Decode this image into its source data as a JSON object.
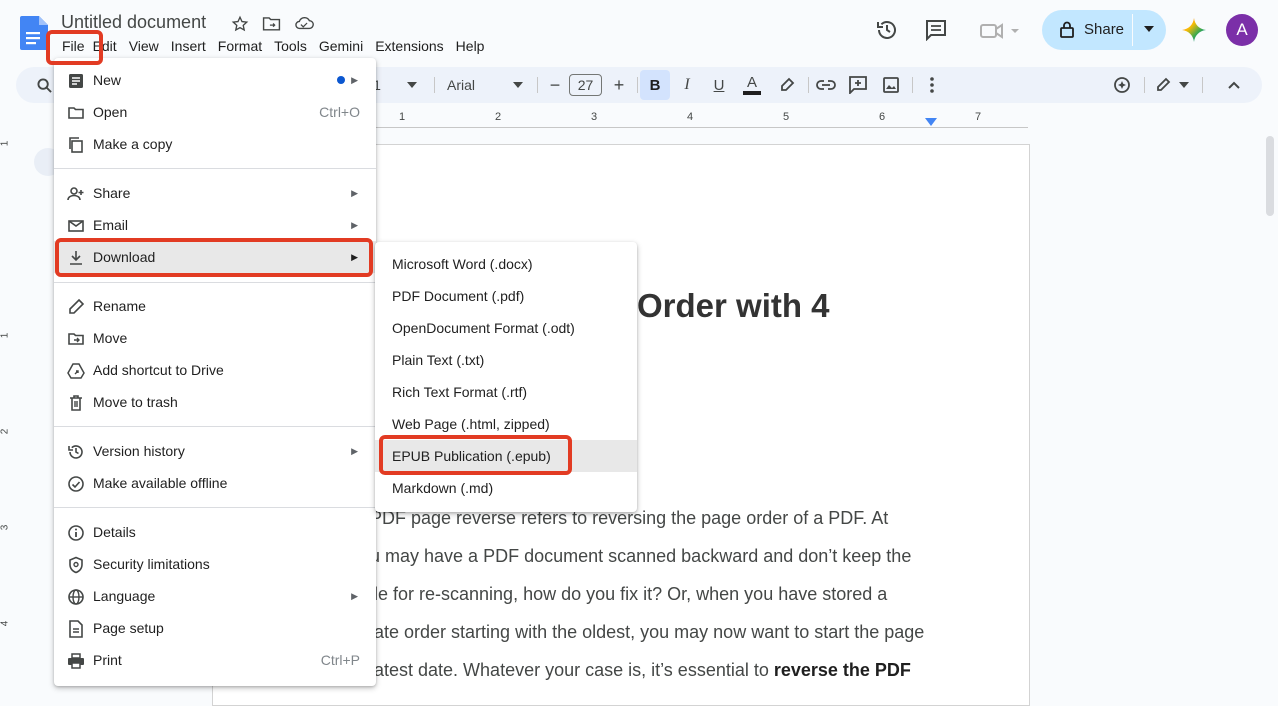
{
  "header": {
    "title": "Untitled document",
    "share_label": "Share",
    "avatar_letter": "A"
  },
  "menubar": [
    "File",
    "Edit",
    "View",
    "Insert",
    "Format",
    "Tools",
    "Gemini",
    "Extensions",
    "Help"
  ],
  "toolbar": {
    "zoom_partial": "1",
    "font": "Arial",
    "font_size": "27",
    "minus": "−",
    "plus": "+",
    "bold": "B",
    "italic": "I",
    "underline": "U",
    "text_color": "A"
  },
  "ruler": [
    "1",
    "2",
    "3",
    "4",
    "5",
    "6",
    "7"
  ],
  "vruler": [
    "1",
    "1",
    "2",
    "3",
    "4"
  ],
  "file_menu": {
    "items": [
      {
        "label": "New",
        "icon": "doc-icon",
        "has_submenu": true,
        "dot": true
      },
      {
        "label": "Open",
        "icon": "folder-open-icon",
        "shortcut": "Ctrl+O"
      },
      {
        "label": "Make a copy",
        "icon": "copy-icon"
      },
      {
        "label": "Share",
        "icon": "person-add-icon",
        "has_submenu": true
      },
      {
        "label": "Email",
        "icon": "email-icon",
        "has_submenu": true
      },
      {
        "label": "Download",
        "icon": "download-icon",
        "has_submenu": true
      },
      {
        "label": "Rename",
        "icon": "pencil-icon"
      },
      {
        "label": "Move",
        "icon": "move-folder-icon"
      },
      {
        "label": "Add shortcut to Drive",
        "icon": "drive-shortcut-icon"
      },
      {
        "label": "Move to trash",
        "icon": "trash-icon"
      },
      {
        "label": "Version history",
        "icon": "history-icon",
        "has_submenu": true
      },
      {
        "label": "Make available offline",
        "icon": "offline-icon"
      },
      {
        "label": "Details",
        "icon": "info-icon"
      },
      {
        "label": "Security limitations",
        "icon": "shield-icon"
      },
      {
        "label": "Language",
        "icon": "globe-icon",
        "has_submenu": true
      },
      {
        "label": "Page setup",
        "icon": "page-setup-icon"
      },
      {
        "label": "Print",
        "icon": "print-icon",
        "shortcut": "Ctrl+P"
      }
    ]
  },
  "download_menu": {
    "items": [
      "Microsoft Word (.docx)",
      "PDF Document (.pdf)",
      "OpenDocument Format (.odt)",
      "Plain Text (.txt)",
      "Rich Text Format (.rtf)",
      "Web Page (.html, zipped)",
      "EPUB Publication (.epub)",
      "Markdown (.md)"
    ]
  },
  "document": {
    "heading_fragment": "Order with 4",
    "lines": [
      "PDF page reverse refers to reversing the page order of a PDF. At",
      "u may have a PDF document scanned backward and don’t keep the",
      "ile for re-scanning, how do you fix it? Or, when you have stored a",
      "late order starting with the oldest, you may now want to start the page",
      "latest date. Whatever your case is, it’s essential to "
    ],
    "bold_tail": "reverse the PDF"
  },
  "colors": {
    "accent": "#0b57d0",
    "share_bg": "#c2e7ff",
    "highlight": "#e23b23",
    "avatar": "#7b2fa8",
    "toolbar_bg": "#edf2fa"
  }
}
